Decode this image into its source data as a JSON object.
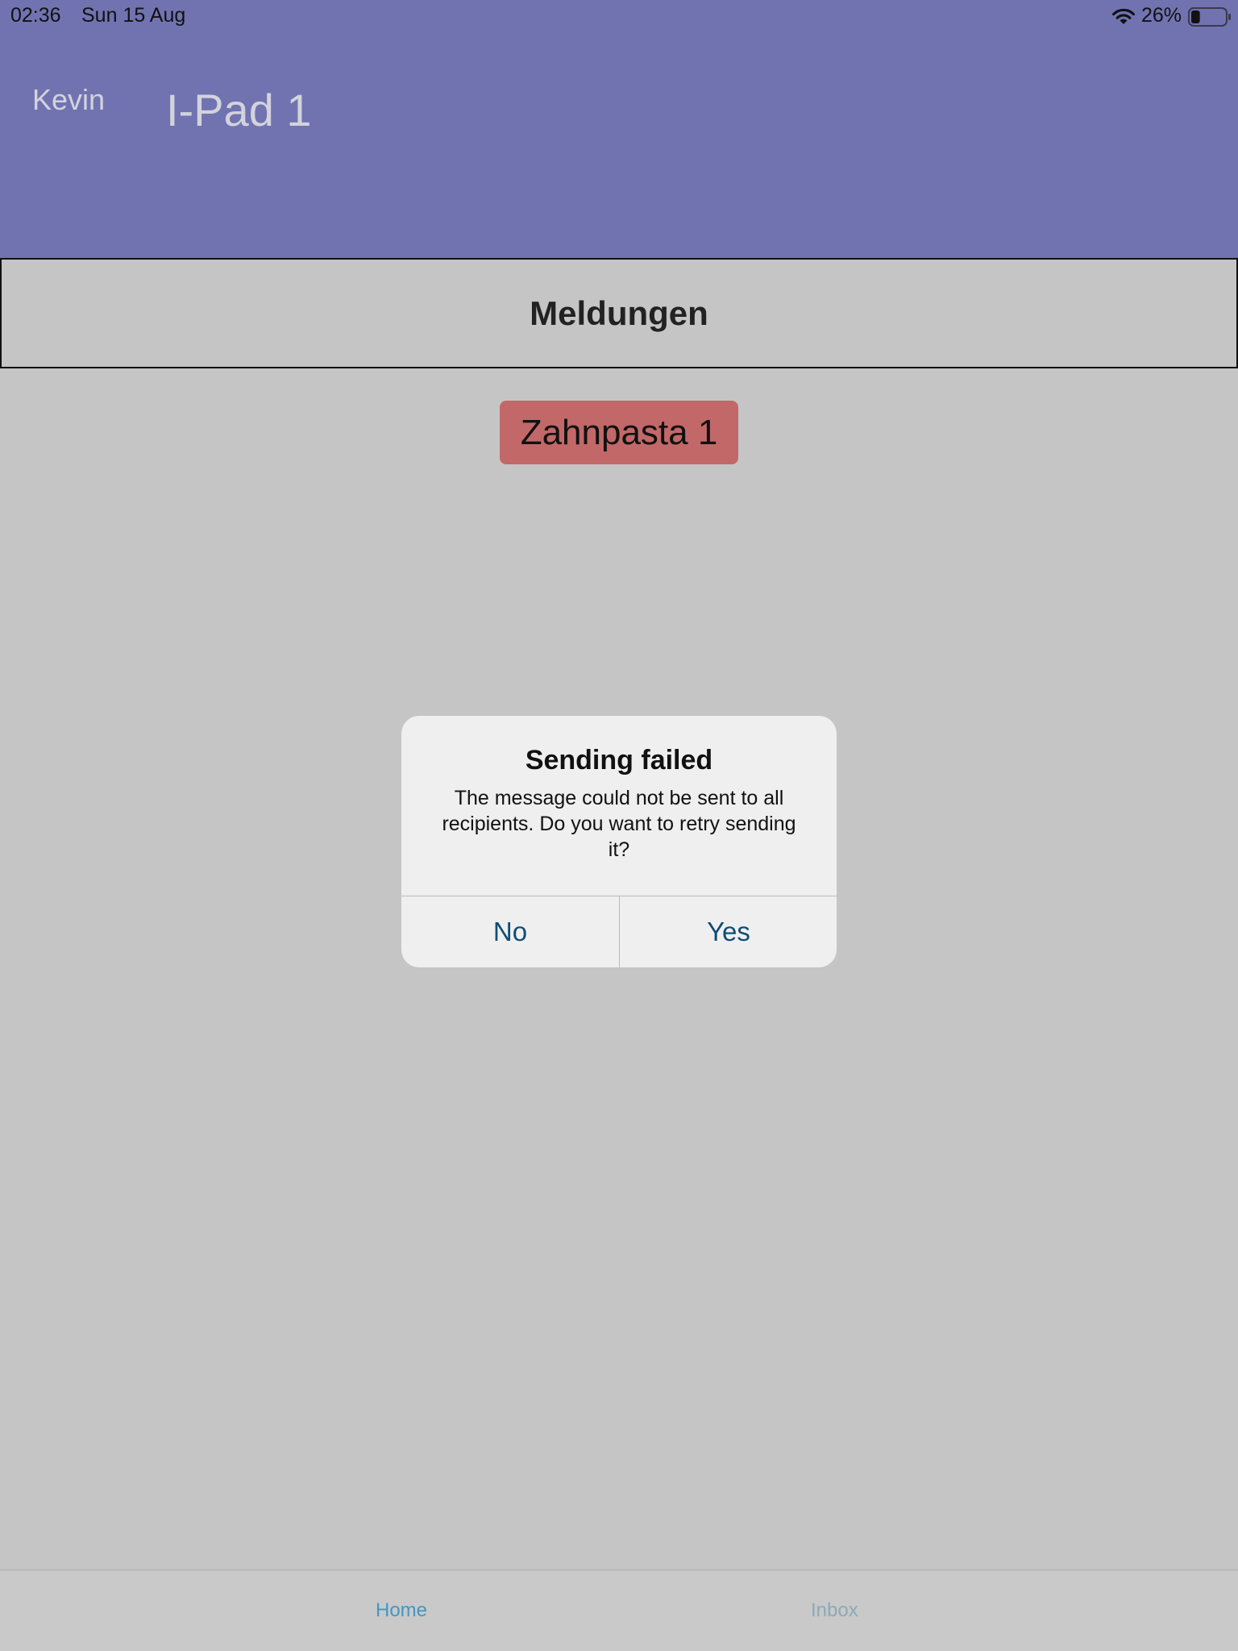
{
  "status_bar": {
    "time": "02:36",
    "date": "Sun 15 Aug",
    "battery_percent": "26%",
    "battery_level": 0.26,
    "wifi_icon": "wifi-icon",
    "battery_icon": "battery-icon"
  },
  "header": {
    "user_name": "Kevin",
    "device_name": "I-Pad 1",
    "background_color": "#7173b1"
  },
  "section": {
    "title": "Meldungen"
  },
  "message_chip": {
    "label": "Zahnpasta 1",
    "color": "#c26868"
  },
  "dialog": {
    "title": "Sending failed",
    "message": "The message could not be sent to all recipients. Do you want to retry sending it?",
    "no_label": "No",
    "yes_label": "Yes",
    "button_color": "#0e4e73"
  },
  "tab_bar": {
    "tabs": [
      {
        "label": "Home",
        "active": true
      },
      {
        "label": "Inbox",
        "active": false
      }
    ]
  }
}
